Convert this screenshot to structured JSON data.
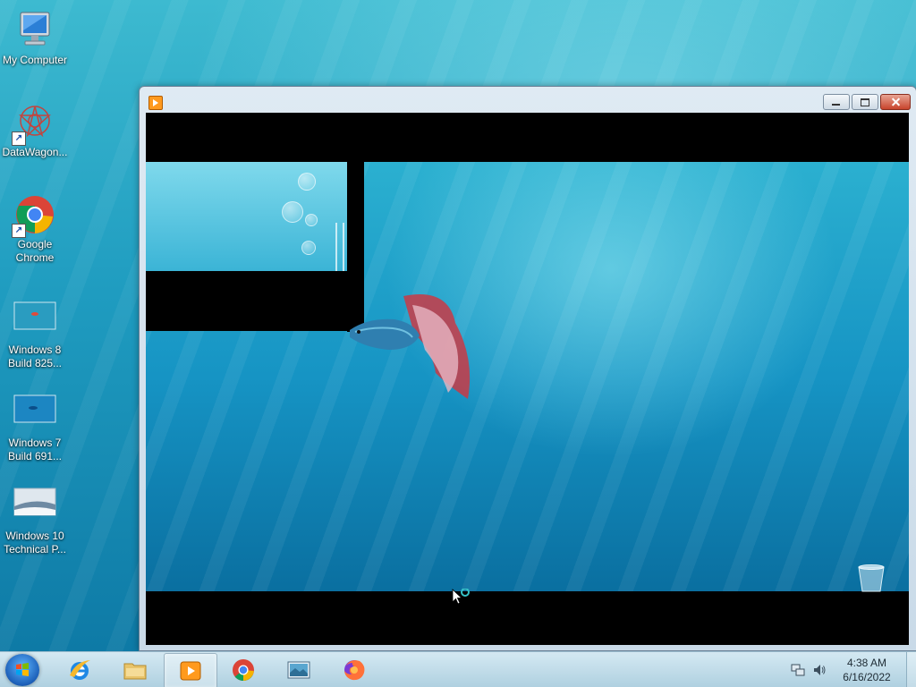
{
  "desktop": {
    "icons": [
      {
        "label": "My Computer"
      },
      {
        "label": "DataWagon..."
      },
      {
        "label_line1": "Google",
        "label_line2": "Chrome"
      },
      {
        "label_line1": "Windows 8",
        "label_line2": "Build 825..."
      },
      {
        "label_line1": "Windows 7",
        "label_line2": "Build 691..."
      },
      {
        "label_line1": "Windows 10",
        "label_line2": "Technical P..."
      }
    ]
  },
  "window": {
    "app_icon": "media-player-icon",
    "buttons": {
      "minimize": "minimize-icon",
      "maximize": "maximize-icon",
      "close": "close-icon"
    }
  },
  "taskbar": {
    "items": [
      {
        "name": "internet-explorer",
        "icon": "ie-icon"
      },
      {
        "name": "file-explorer",
        "icon": "folder-icon"
      },
      {
        "name": "media-player",
        "icon": "media-player-icon",
        "active": true
      },
      {
        "name": "google-chrome",
        "icon": "chrome-icon"
      },
      {
        "name": "photo-viewer",
        "icon": "photo-icon"
      },
      {
        "name": "firefox",
        "icon": "firefox-icon"
      }
    ],
    "clock": {
      "time": "4:38 AM",
      "date": "6/16/2022"
    }
  },
  "colors": {
    "accent": "#1f9cc0",
    "close": "#c8442c"
  }
}
